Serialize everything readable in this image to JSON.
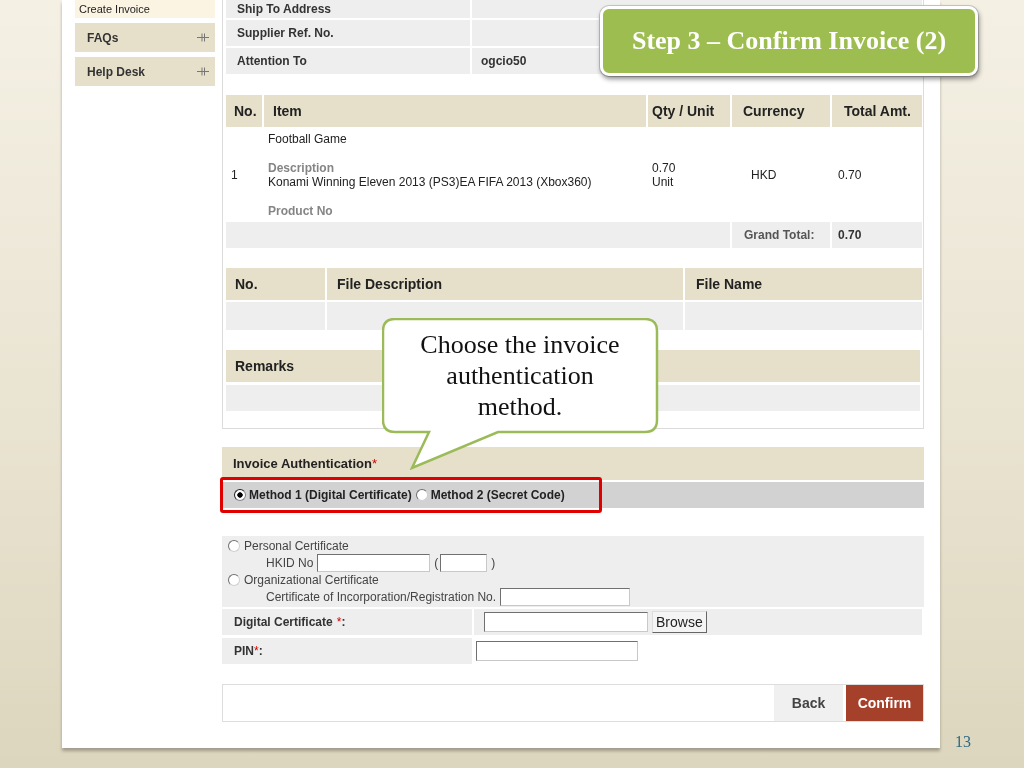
{
  "sidebar": {
    "items": [
      {
        "label": "Create Invoice",
        "kind": "link"
      },
      {
        "label": "FAQs",
        "kind": "section"
      },
      {
        "label": "Help Desk",
        "kind": "section"
      }
    ]
  },
  "details": {
    "rows": [
      {
        "label": "Ship To Address"
      },
      {
        "label": "Supplier Ref. No."
      },
      {
        "label": "Attention To",
        "value": "ogcio50"
      }
    ]
  },
  "step_banner": {
    "title": "Step 3 – Confirm Invoice (2)"
  },
  "items_table": {
    "columns": [
      "No.",
      "Item",
      "Qty / Unit",
      "Currency",
      "Total Amt."
    ],
    "rows": [
      {
        "no": "1",
        "item": "Football Game",
        "description_label": "Description",
        "description": "Konami Winning Eleven 2013 (PS3)EA FIFA 2013 (Xbox360)",
        "product_no_label": "Product No",
        "quantity": "0.70",
        "unit": "Unit",
        "currency": "HKD",
        "total": "0.70"
      }
    ],
    "grand_total_label": "Grand Total:",
    "grand_total": "0.70"
  },
  "files_table": {
    "columns": [
      "No.",
      "File Description",
      "File Name"
    ]
  },
  "remarks": {
    "heading": "Remarks"
  },
  "callout": {
    "text": "Choose the invoice authentication method."
  },
  "authentication": {
    "heading": "Invoice Authentication",
    "required_mark": "*",
    "highlighted": true,
    "methods": [
      {
        "label": "Method 1 (Digital Certificate)",
        "selected": true
      },
      {
        "label": "Method 2 (Secret Code)",
        "selected": false
      }
    ]
  },
  "certificate_types": [
    {
      "label": "Personal Certificate",
      "selected": false,
      "id_label": "HKID No",
      "check_digit": {
        "open": "(",
        "close": ")"
      }
    },
    {
      "label": "Organizational Certificate",
      "selected": false,
      "id_label": "Certificate of Incorporation/Registration No."
    }
  ],
  "form_rows": [
    {
      "kind": "file",
      "label": "Digital Certificate",
      "required_mark": "*",
      "suffix": ":",
      "button": "Browse"
    },
    {
      "kind": "password",
      "label": "PIN",
      "required_mark": "*",
      "suffix": ":"
    }
  ],
  "actions": [
    {
      "label": "Back",
      "kind": "secondary"
    },
    {
      "label": "Confirm",
      "kind": "primary"
    }
  ],
  "page_number": "13"
}
